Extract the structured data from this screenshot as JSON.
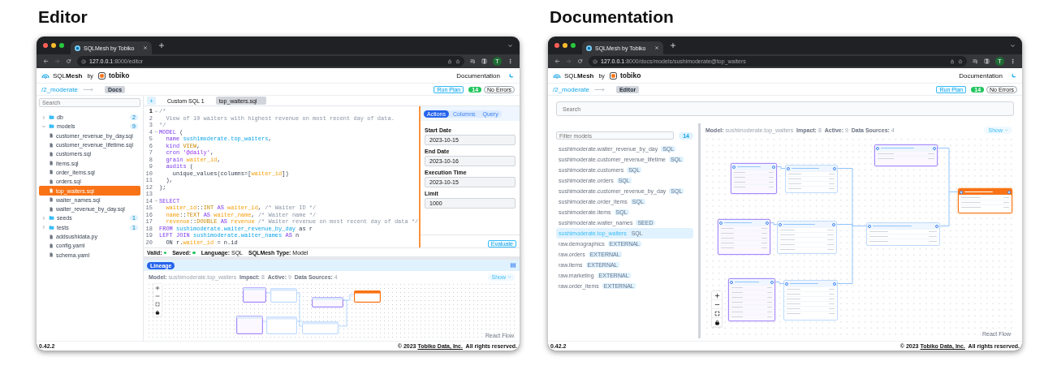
{
  "screens": [
    {
      "kind": "editor",
      "heading": "Editor",
      "browser": {
        "tab_title": "SQLMesh by Tobiko",
        "url": "**127.0.0.1**:8000/editor",
        "avatar": "T"
      },
      "header": {
        "logo": "SQL**Mesh**",
        "by": "by",
        "brand": "tobiko",
        "nav_link": "Documentation"
      },
      "toolbar": {
        "project": "/2_moderate",
        "switch_button": "Docs",
        "run_plan": "Run Plan",
        "count": "14",
        "errors": "No Errors"
      },
      "sidebar": {
        "search_placeholder": "Search",
        "tree": [
          {
            "kind": "folder",
            "name": "db",
            "count": "2",
            "expanded": false
          },
          {
            "kind": "folder",
            "name": "models",
            "count": "9",
            "expanded": true,
            "children": [
              {
                "kind": "file",
                "name": "customer_revenue_by_day.sql",
                "selected": false
              },
              {
                "kind": "file",
                "name": "customer_revenue_lifetime.sql",
                "selected": false
              },
              {
                "kind": "file",
                "name": "customers.sql",
                "selected": false
              },
              {
                "kind": "file",
                "name": "items.sql",
                "selected": false
              },
              {
                "kind": "file",
                "name": "order_items.sql",
                "selected": false
              },
              {
                "kind": "file",
                "name": "orders.sql",
                "selected": false
              },
              {
                "kind": "file",
                "name": "top_waiters.sql",
                "selected": true
              },
              {
                "kind": "file",
                "name": "waiter_names.sql",
                "selected": false
              },
              {
                "kind": "file",
                "name": "waiter_revenue_by_day.sql",
                "selected": false
              }
            ]
          },
          {
            "kind": "folder",
            "name": "seeds",
            "count": "1",
            "expanded": false
          },
          {
            "kind": "folder",
            "name": "tests",
            "count": "1",
            "expanded": false
          },
          {
            "kind": "file",
            "name": "addsushidata.py",
            "selected": false
          },
          {
            "kind": "file",
            "name": "config.yaml",
            "selected": false
          },
          {
            "kind": "file",
            "name": "schema.yaml",
            "selected": false
          }
        ]
      },
      "new_tab": "+",
      "editor_tabs": [
        {
          "label": "Custom SQL 1",
          "selected": false
        },
        {
          "label": "top_waiters.sql",
          "selected": true
        }
      ],
      "code": [
        {
          "number": "1",
          "fold": true,
          "tokens": [
            {
              "kind": "comment",
              "text": "/*"
            }
          ]
        },
        {
          "number": "2",
          "fold": false,
          "tokens": [
            {
              "kind": "comment",
              "text": "  View of 10 waiters with highest revenue on most recent day of data."
            }
          ]
        },
        {
          "number": "3",
          "fold": false,
          "tokens": [
            {
              "kind": "comment",
              "text": "*/"
            }
          ]
        },
        {
          "number": "4",
          "fold": true,
          "tokens": [
            {
              "kind": "keyword",
              "text": "MODEL"
            },
            {
              "kind": "plain",
              "text": " ("
            }
          ]
        },
        {
          "number": "5",
          "fold": false,
          "tokens": [
            {
              "kind": "keyword",
              "text": "  name "
            },
            {
              "kind": "ref",
              "text": "sushimoderate.top_waiters"
            },
            {
              "kind": "plain",
              "text": ","
            }
          ]
        },
        {
          "number": "6",
          "fold": false,
          "tokens": [
            {
              "kind": "keyword",
              "text": "  kind "
            },
            {
              "kind": "type",
              "text": "VIEW"
            },
            {
              "kind": "plain",
              "text": ","
            }
          ]
        },
        {
          "number": "7",
          "fold": false,
          "tokens": [
            {
              "kind": "keyword",
              "text": "  cron "
            },
            {
              "kind": "string",
              "text": "'@daily'"
            },
            {
              "kind": "plain",
              "text": ","
            }
          ]
        },
        {
          "number": "8",
          "fold": false,
          "tokens": [
            {
              "kind": "keyword",
              "text": "  grain "
            },
            {
              "kind": "column",
              "text": "waiter_id"
            },
            {
              "kind": "plain",
              "text": ","
            }
          ]
        },
        {
          "number": "9",
          "fold": false,
          "tokens": [
            {
              "kind": "keyword",
              "text": "  audits"
            },
            {
              "kind": "plain",
              "text": " ("
            }
          ]
        },
        {
          "number": "10",
          "fold": false,
          "tokens": [
            {
              "kind": "plain",
              "text": "    unique_values(columns=["
            },
            {
              "kind": "column",
              "text": "waiter_id"
            },
            {
              "kind": "plain",
              "text": "])"
            }
          ]
        },
        {
          "number": "11",
          "fold": false,
          "tokens": [
            {
              "kind": "plain",
              "text": "  ),"
            }
          ]
        },
        {
          "number": "12",
          "fold": false,
          "tokens": [
            {
              "kind": "plain",
              "text": ");"
            }
          ]
        },
        {
          "number": "13",
          "fold": false
        },
        {
          "number": "14",
          "fold": true,
          "tokens": [
            {
              "kind": "keyword",
              "text": "SELECT"
            }
          ]
        },
        {
          "number": "15",
          "fold": false,
          "tokens": [
            {
              "kind": "column",
              "text": "  waiter_id"
            },
            {
              "kind": "plain",
              "text": "::"
            },
            {
              "kind": "type",
              "text": "INT"
            },
            {
              "kind": "keyword",
              "text": " AS "
            },
            {
              "kind": "column",
              "text": "waiter_id"
            },
            {
              "kind": "plain",
              "text": ", "
            },
            {
              "kind": "comment",
              "text": "/* Waiter ID */"
            }
          ]
        },
        {
          "number": "16",
          "fold": false,
          "tokens": [
            {
              "kind": "column",
              "text": "  name"
            },
            {
              "kind": "plain",
              "text": "::"
            },
            {
              "kind": "type",
              "text": "TEXT"
            },
            {
              "kind": "keyword",
              "text": " AS "
            },
            {
              "kind": "column",
              "text": "waiter_name"
            },
            {
              "kind": "plain",
              "text": ", "
            },
            {
              "kind": "comment",
              "text": "/* Waiter name */"
            }
          ]
        },
        {
          "number": "17",
          "fold": false,
          "tokens": [
            {
              "kind": "column",
              "text": "  revenue"
            },
            {
              "kind": "plain",
              "text": "::"
            },
            {
              "kind": "type",
              "text": "DOUBLE"
            },
            {
              "kind": "keyword",
              "text": " AS "
            },
            {
              "kind": "column",
              "text": "revenue"
            },
            {
              "kind": "comment",
              "text": " /* Waiter revenue on most recent day of data */"
            }
          ]
        },
        {
          "number": "18",
          "fold": false,
          "tokens": [
            {
              "kind": "keyword",
              "text": "FROM "
            },
            {
              "kind": "ref",
              "text": "sushimoderate.waiter_revenue_by_day"
            },
            {
              "kind": "plain",
              "text": " as r"
            }
          ]
        },
        {
          "number": "19",
          "fold": false,
          "tokens": [
            {
              "kind": "keyword",
              "text": "LEFT JOIN "
            },
            {
              "kind": "ref",
              "text": "sushimoderate.waiter_names"
            },
            {
              "kind": "keyword",
              "text": " AS"
            },
            {
              "kind": "plain",
              "text": " n"
            }
          ]
        },
        {
          "number": "20",
          "fold": false,
          "tokens": [
            {
              "kind": "plain",
              "text": "  ON r."
            },
            {
              "kind": "column",
              "text": "waiter_id"
            },
            {
              "kind": "plain",
              "text": " = n.id"
            }
          ]
        }
      ],
      "actions": {
        "tabs": [
          {
            "label": "Actions",
            "selected": true
          },
          {
            "label": "Columns",
            "selected": false
          },
          {
            "label": "Query",
            "selected": false
          }
        ],
        "fields": [
          {
            "label": "Start Date",
            "value": "2023-10-15"
          },
          {
            "label": "End Date",
            "value": "2023-10-16"
          },
          {
            "label": "Execution Time",
            "value": "2023-10-15"
          },
          {
            "label": "Limit",
            "value": "1000"
          }
        ],
        "button": "Evaluate"
      },
      "status": [
        {
          "text": "Valid:",
          "ok": true
        },
        {
          "text": "Saved:",
          "ok": true
        },
        {
          "text": "**Language:** SQL"
        },
        {
          "text": "**SQLMesh Type:** Model"
        }
      ],
      "lineage": {
        "button": "Lineage",
        "info": "**Model:** sushimoderate.top_waiters  **Impact:** 8  **Active:** 9  **Data Sources:** 4",
        "show": "Show",
        "attribution": "React Flow",
        "nodes": [
          {
            "kind": "source",
            "selected": false
          },
          {
            "kind": "model",
            "selected": false
          },
          {
            "kind": "source",
            "selected": false
          },
          {
            "kind": "model",
            "selected": true
          },
          {
            "kind": "source",
            "selected": false
          },
          {
            "kind": "model",
            "selected": false
          },
          {
            "kind": "model",
            "selected": false
          }
        ]
      },
      "footer": {
        "version": "0.42.2",
        "copyright": "© 2023",
        "company": "Tobiko Data, Inc.",
        "rights": "All rights reserved."
      }
    },
    {
      "kind": "docs",
      "heading": "Documentation",
      "browser": {
        "tab_title": "SQLMesh by Tobiko",
        "url": "**127.0.0.1**:8000/docs/models/sushimoderate@top_waiters",
        "avatar": "T"
      },
      "header": {
        "logo": "SQL**Mesh**",
        "by": "by",
        "brand": "tobiko",
        "nav_link": "Documentation"
      },
      "toolbar": {
        "project": "/2_moderate",
        "switch_button": "Editor",
        "run_plan": "Run Plan",
        "count": "14",
        "errors": "No Errors"
      },
      "search_placeholder": "Search",
      "models": {
        "filter_placeholder": "Filter models",
        "count": "14",
        "items": [
          {
            "name": "sushimoderate.waiter_revenue_by_day",
            "tag": "SQL",
            "selected": false
          },
          {
            "name": "sushimoderate.customer_revenue_lifetime",
            "tag": "SQL",
            "selected": false
          },
          {
            "name": "sushimoderate.customers",
            "tag": "SQL",
            "selected": false
          },
          {
            "name": "sushimoderate.orders",
            "tag": "SQL",
            "selected": false
          },
          {
            "name": "sushimoderate.customer_revenue_by_day",
            "tag": "SQL",
            "selected": false
          },
          {
            "name": "sushimoderate.order_items",
            "tag": "SQL",
            "selected": false
          },
          {
            "name": "sushimoderate.items",
            "tag": "SQL",
            "selected": false
          },
          {
            "name": "sushimoderate.waiter_names",
            "tag": "SEED",
            "selected": false
          },
          {
            "name": "sushimoderate.top_waiters",
            "tag": "SQL",
            "selected": true
          },
          {
            "name": "raw.demographics",
            "tag": "EXTERNAL",
            "selected": false
          },
          {
            "name": "raw.orders",
            "tag": "EXTERNAL",
            "selected": false
          },
          {
            "name": "raw.items",
            "tag": "EXTERNAL",
            "selected": false
          },
          {
            "name": "raw.marketing",
            "tag": "EXTERNAL",
            "selected": false
          },
          {
            "name": "raw.order_items",
            "tag": "EXTERNAL",
            "selected": false
          }
        ]
      },
      "lineage": {
        "info": "**Model:** sushimoderate.top_waiters  **Impact:** 8  **Active:** 9  **Data Sources:** 4",
        "show": "Show",
        "attribution": "React Flow",
        "nodes": [
          {
            "kind": "source",
            "selected": false
          },
          {
            "kind": "model",
            "selected": false
          },
          {
            "kind": "source",
            "selected": false
          },
          {
            "kind": "model",
            "selected": true
          },
          {
            "kind": "source",
            "selected": false
          },
          {
            "kind": "model",
            "selected": false
          },
          {
            "kind": "model",
            "selected": false
          },
          {
            "kind": "source",
            "selected": false
          },
          {
            "kind": "model",
            "selected": false
          }
        ]
      },
      "footer": {
        "version": "0.42.2",
        "copyright": "© 2023",
        "company": "Tobiko Data, Inc.",
        "rights": "All rights reserved."
      }
    }
  ]
}
